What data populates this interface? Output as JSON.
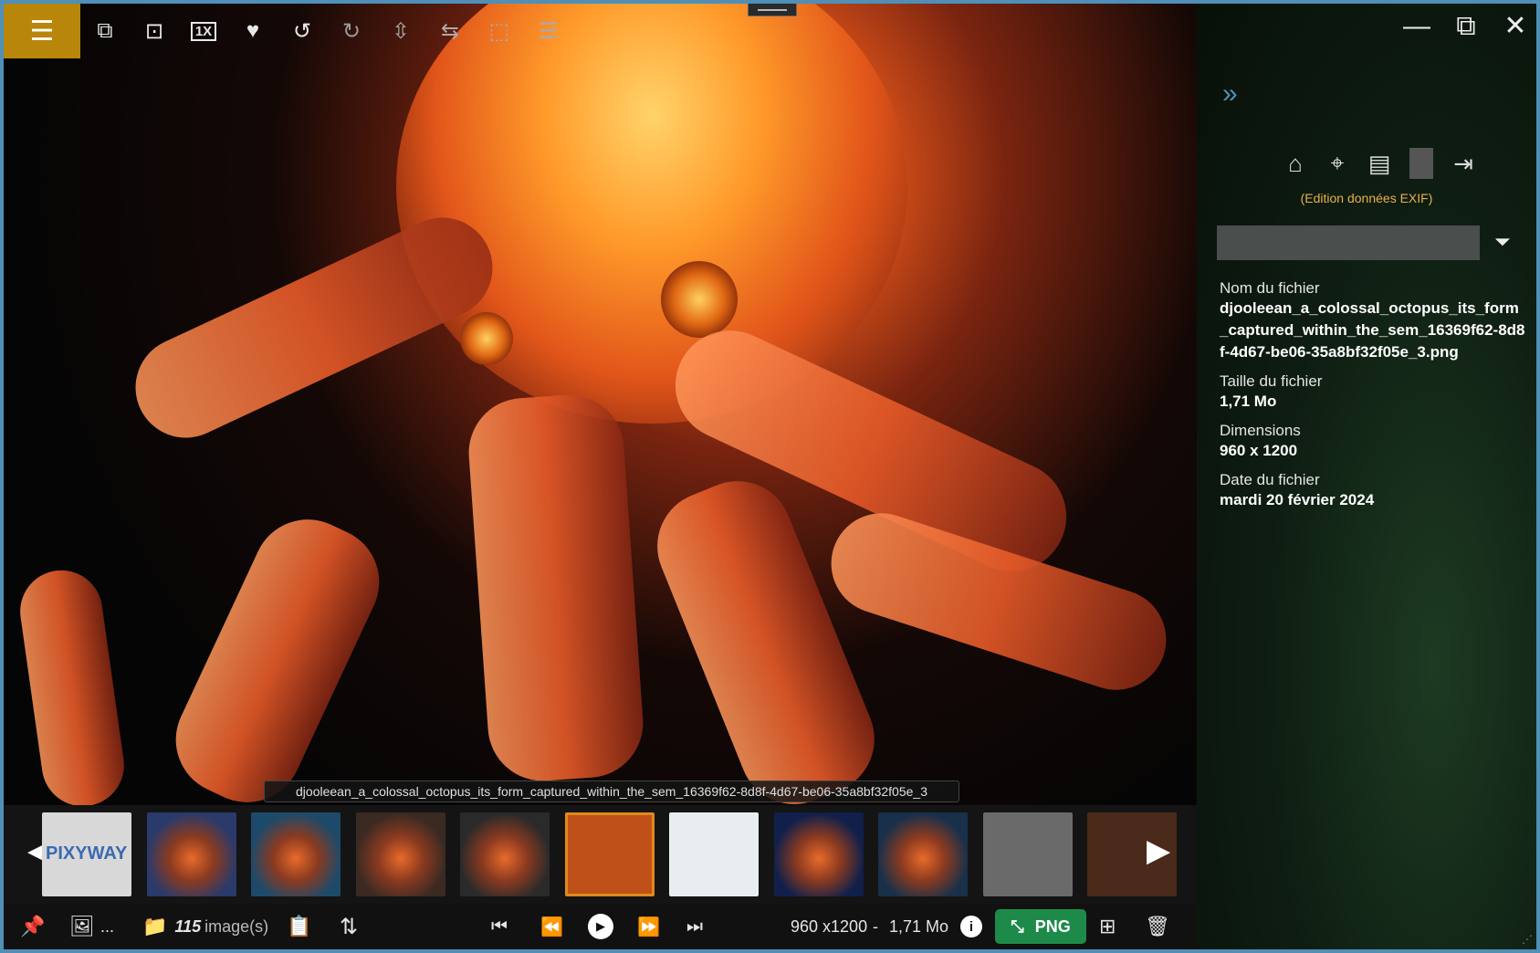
{
  "toolbar": {
    "icons": [
      "menu-icon",
      "slideshow-icon",
      "fit-screen-icon",
      "zoom-1x-icon",
      "favorite-icon",
      "rotate-left-icon",
      "rotate-right-icon",
      "flip-vertical-icon",
      "flip-horizontal-icon",
      "crop-icon",
      "adjust-icon"
    ],
    "zoom_label": "1X"
  },
  "window_controls": [
    "minimize-icon",
    "restore-icon",
    "close-icon"
  ],
  "panel": {
    "exif_edit_label": "(Edition données EXIF)",
    "search_value": "",
    "fields": [
      {
        "label": "Nom du fichier",
        "value": "djooleean_a_colossal_octopus_its_form_captured_within_the_sem_16369f62-8d8f-4d67-be06-35a8bf32f05e_3.png"
      },
      {
        "label": "Taille du fichier",
        "value": "1,71 Mo"
      },
      {
        "label": "Dimensions",
        "value": "960 x 1200"
      },
      {
        "label": "Date du fichier",
        "value": "mardi 20 février 2024"
      }
    ]
  },
  "caption": "djooleean_a_colossal_octopus_its_form_captured_within_the_sem_16369f62-8d8f-4d67-be06-35a8bf32f05e_3",
  "thumbnails": [
    {
      "name": "pixyway-thumb",
      "text": "PIXYWAY",
      "bg": "#d8d8d8",
      "fg": "#3a6ab0"
    },
    {
      "name": "octopus-globe-thumb-1",
      "bg": "#2a3a6a"
    },
    {
      "name": "octopus-globe-thumb-2",
      "bg": "#1e4a6a"
    },
    {
      "name": "octopus-globe-thumb-3",
      "bg": "#3a2a22"
    },
    {
      "name": "octopus-globe-thumb-4",
      "bg": "#2a2a2a"
    },
    {
      "name": "octopus-thumb-selected",
      "bg": "#c0501a"
    },
    {
      "name": "dinosaur-thumb",
      "bg": "#e8eef0"
    },
    {
      "name": "octopus-globe-thumb-5",
      "bg": "#10204a"
    },
    {
      "name": "octopus-globe-thumb-6",
      "bg": "#18304a"
    },
    {
      "name": "legs-thumb",
      "bg": "#6a6a6a"
    },
    {
      "name": "octopus-brown-thumb",
      "bg": "#4a2a1a"
    }
  ],
  "status": {
    "image_count": "115",
    "image_unit": "image(s)",
    "more": "...",
    "dimensions": "960 x1200",
    "separator": "-",
    "size": "1,71 Mo",
    "format": "PNG"
  },
  "colors": {
    "accent_gold": "#b8860b",
    "png_green": "#1e8a4a",
    "exif_label": "#e6b24a",
    "window_border": "#4f8fb8"
  }
}
